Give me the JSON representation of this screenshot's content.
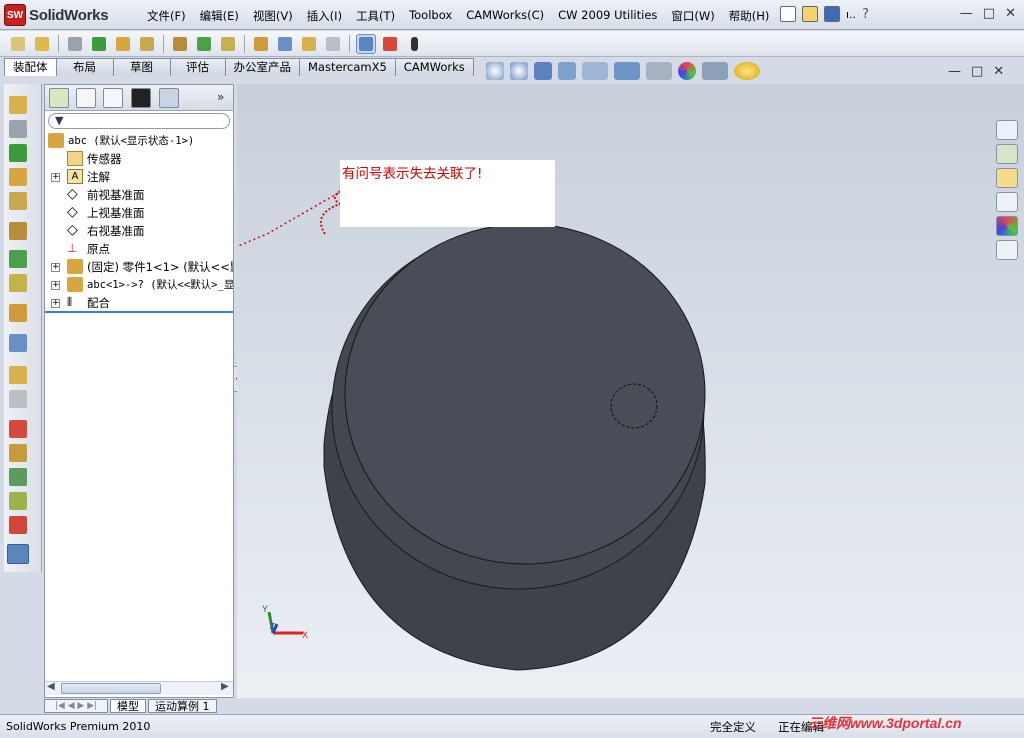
{
  "app": {
    "brand": "SolidWorks",
    "logo_text": "SW",
    "status_text": "SolidWorks Premium 2010"
  },
  "menu": [
    "文件(F)",
    "编辑(E)",
    "视图(V)",
    "插入(I)",
    "工具(T)",
    "Toolbox",
    "CAMWorks(C)",
    "CW 2009 Utilities",
    "窗口(W)",
    "帮助(H)"
  ],
  "quick_access": {
    "more": "ı..",
    "help": "?"
  },
  "window_buttons": {
    "minimize": "—",
    "restore": "□",
    "close": "✕"
  },
  "cm_tabs": [
    "装配体",
    "布局",
    "草图",
    "评估",
    "办公室产品",
    "MastercamX5",
    "CAMWorks"
  ],
  "tree": {
    "root": "abc  (默认<显示状态-1>)",
    "items": [
      "传感器",
      "注解",
      "前视基准面",
      "上视基准面",
      "右视基准面",
      "原点",
      "(固定) 零件1<1> (默认<<默",
      "abc<1>->? (默认<<默认>_显",
      "配合"
    ]
  },
  "bottom_tabs": [
    "模型",
    "运动算例 1"
  ],
  "annotation": "有问号表示失去关联了!",
  "triad": {
    "x": "X",
    "y": "Y",
    "z": "Z"
  },
  "status": {
    "definition": "完全定义",
    "editing": "正在编辑"
  },
  "watermark": "三维网www.3dportal.cn",
  "colors": {
    "model": "#4a4c57",
    "accent_red": "#c8201e",
    "viewport_top": "#c7cfdb",
    "viewport_bottom": "#ecf0f5"
  }
}
